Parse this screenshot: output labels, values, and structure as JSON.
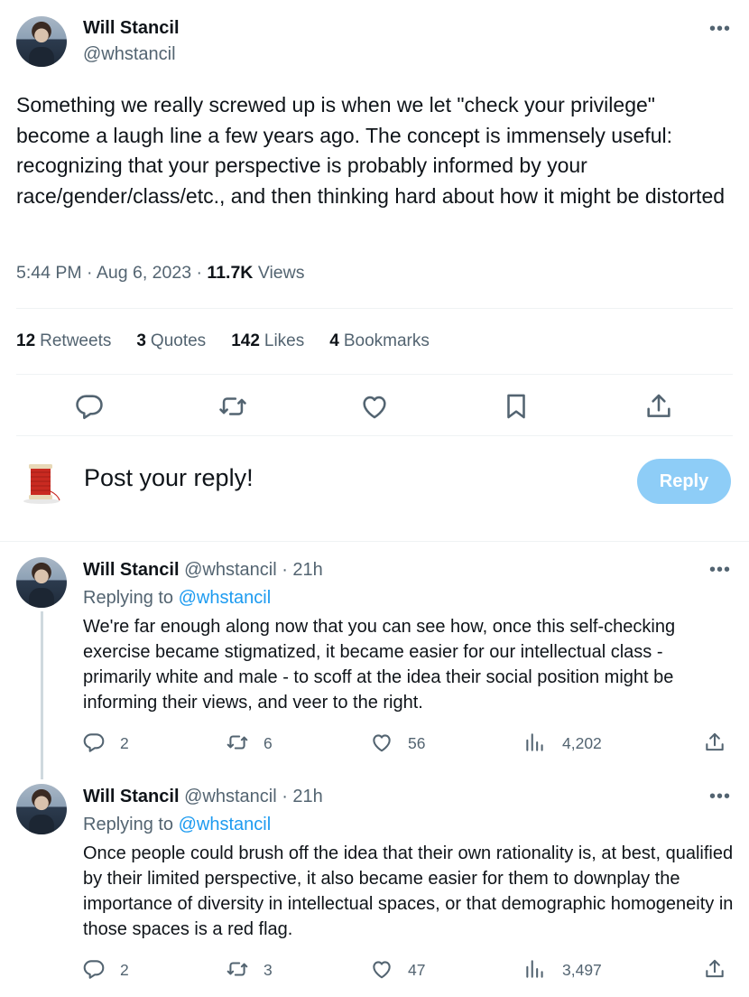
{
  "main_post": {
    "author_name": "Will Stancil",
    "author_handle": "@whstancil",
    "text": "Something we really screwed up is when we let \"check your privilege\" become a laugh line a few years ago. The concept is immensely useful: recognizing that your perspective is probably informed by your race/gender/class/etc., and then thinking hard about how it might be distorted",
    "time": "5:44 PM",
    "date": "Aug 6, 2023",
    "views_count": "11.7K",
    "views_label": "Views",
    "stats": {
      "retweets_count": "12",
      "retweets_label": "Retweets",
      "quotes_count": "3",
      "quotes_label": "Quotes",
      "likes_count": "142",
      "likes_label": "Likes",
      "bookmarks_count": "4",
      "bookmarks_label": "Bookmarks"
    }
  },
  "composer": {
    "prompt": "Post your reply!",
    "button_label": "Reply"
  },
  "replies": [
    {
      "author_name": "Will Stancil",
      "author_handle": "@whstancil",
      "age": "· 21h",
      "replying_label": "Replying to",
      "replying_mention": "@whstancil",
      "text": "We're far enough along now that you can see how, once this self-checking exercise became stigmatized, it became easier for our intellectual class - primarily white and male - to scoff at the idea their social position might be informing their views, and veer to the right.",
      "replies": "2",
      "retweets": "6",
      "likes": "56",
      "views": "4,202"
    },
    {
      "author_name": "Will Stancil",
      "author_handle": "@whstancil",
      "age": "· 21h",
      "replying_label": "Replying to",
      "replying_mention": "@whstancil",
      "text": "Once people could brush off the idea that their own rationality is, at best, qualified by their limited perspective, it also became easier for them to downplay the importance of diversity in intellectual spaces, or that demographic homogeneity in those spaces is a red flag.",
      "replies": "2",
      "retweets": "3",
      "likes": "47",
      "views": "3,497"
    }
  ],
  "icons": {
    "more": "more-horizontal-icon",
    "reply": "speech-bubble-icon",
    "retweet": "retweet-icon",
    "like": "heart-icon",
    "bookmark": "bookmark-icon",
    "share": "share-upload-icon",
    "views": "bar-chart-icon",
    "composer_avatar": "thread-spool-icon"
  },
  "colors": {
    "text": "#0f1419",
    "muted": "#536471",
    "accent": "#1d9bf0",
    "reply_button": "#8ecdf7",
    "divider": "#eff3f4"
  }
}
